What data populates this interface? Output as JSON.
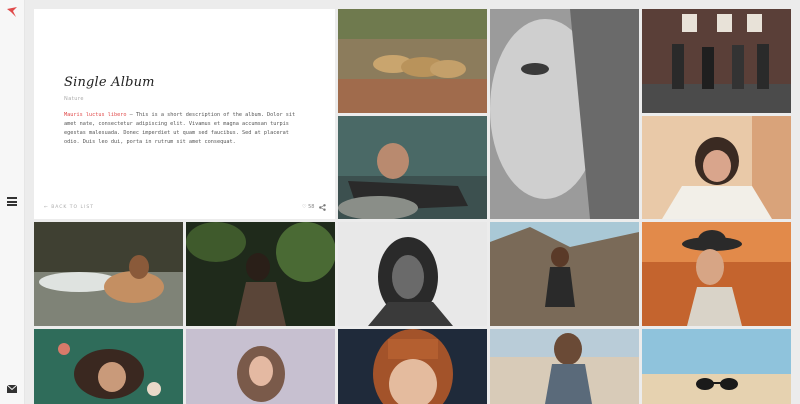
{
  "sidebar": {
    "logo_icon": "bird-logo-icon",
    "menu_icon": "hamburger-menu-icon",
    "mail_icon": "envelope-icon"
  },
  "album": {
    "title": "Single Album",
    "subtitle": "Nature",
    "description_highlight": "Mauris luctus libero",
    "description_body": " – This is a short description of the album. Dolor sit amet nate, consectetur adipiscing elit. Vivamus et magna accumsan turpis egestas malesuada. Donec imperdiet ut quam sed faucibus. Sed at placerat odio. Duis leo dui, porta in rutrum sit amet consequat.",
    "back_label": "← BACK TO LIST",
    "likes": "♡ 58",
    "accent_color": "#e04a4a"
  },
  "gallery": {
    "photos": [
      "lions-on-rocks",
      "woman-lying-by-lake",
      "close-up-face-with-freckles",
      "group-in-front-of-house",
      "woman-covering-face",
      "woman-on-beach-waves",
      "woman-in-dark-forest",
      "woman-black-and-white",
      "woman-on-rocks",
      "woman-with-hat-in-grass",
      "woman-in-water-with-flowers",
      "woman-in-pastel-light",
      "woman-with-red-bangs",
      "woman-on-beach-wall",
      "sunglasses-on-sand"
    ]
  }
}
